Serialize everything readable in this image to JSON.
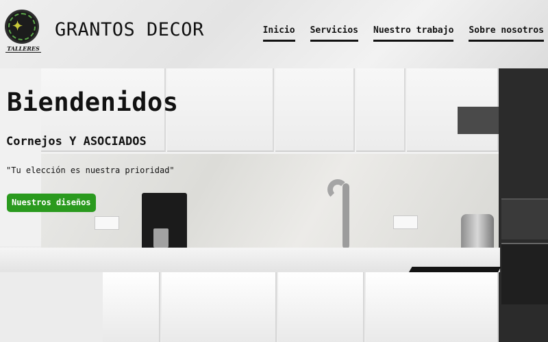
{
  "header": {
    "logo_caption": "TALLERES",
    "brand": "GRANTOS DECOR"
  },
  "nav": {
    "items": [
      {
        "label": "Inicio"
      },
      {
        "label": "Servicios"
      },
      {
        "label": "Nuestro trabajo"
      },
      {
        "label": "Sobre nosotros"
      }
    ]
  },
  "hero": {
    "title": "Biendenidos",
    "subtitle": "Cornejos Y ASOCIADOS",
    "quote": "\"Tu elección es nuestra prioridad\"",
    "cta_label": "Nuestros diseños"
  },
  "colors": {
    "cta_background": "#2a9a1e",
    "text": "#111111",
    "nav_underline": "#111111"
  },
  "icons": {
    "logo": "talleres-emblem-icon"
  }
}
